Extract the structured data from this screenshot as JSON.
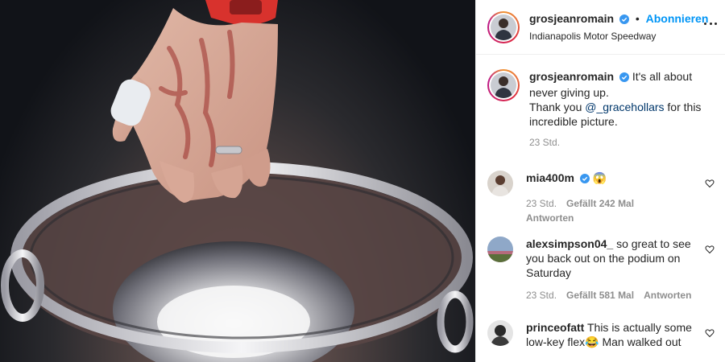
{
  "post": {
    "username": "grosjeanromain",
    "follow_label": "Abonnieren",
    "separator": "•",
    "location": "Indianapolis Motor Speedway"
  },
  "caption": {
    "username": "grosjeanromain",
    "line1": "It's all about never giving up.",
    "line2_prefix": "Thank you",
    "mention": "@_gracehollars",
    "line2_suffix": "for this incredible picture.",
    "time": "23 Std."
  },
  "comments": [
    {
      "username": "mia400m",
      "text": "😱",
      "time": "23 Std.",
      "likes": "Gefällt 242 Mal",
      "reply": "Antworten",
      "verified": true
    },
    {
      "username": "alexsimpson04_",
      "text": "so great to see you back out on the podium on Saturday",
      "time": "23 Std.",
      "likes": "Gefällt 581 Mal",
      "reply": "Antworten",
      "verified": false
    },
    {
      "username": "princeofatt",
      "text": "This is actually some low-key flex😂 Man walked out",
      "verified": false
    }
  ],
  "colors": {
    "accent": "#0095f6",
    "verified": "#3897f0",
    "mention": "#00376b",
    "meta": "#8e8e8e"
  },
  "icons": [
    "verified-badge-icon",
    "more-options-icon",
    "heart-icon"
  ]
}
